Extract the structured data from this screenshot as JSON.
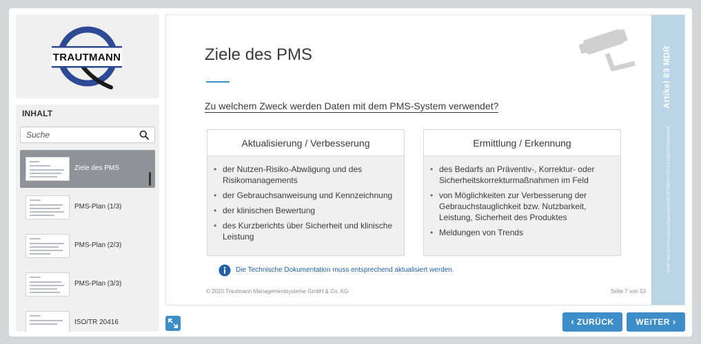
{
  "logo": {
    "text": "TRAUTMANN"
  },
  "sidebar": {
    "heading": "INHALT",
    "search_placeholder": "Suche",
    "items": [
      {
        "label": "Ziele des PMS",
        "active": true
      },
      {
        "label": "PMS-Plan (1/3)",
        "active": false
      },
      {
        "label": "PMS-Plan (2/3)",
        "active": false
      },
      {
        "label": "PMS-Plan (3/3)",
        "active": false
      },
      {
        "label": "ISO/TR 20416",
        "active": false
      }
    ]
  },
  "slide": {
    "title": "Ziele des PMS",
    "question": "Zu welchem Zweck werden Daten mit dem PMS-System verwendet?",
    "cards": [
      {
        "heading": "Aktualisierung / Verbesserung",
        "bullets": [
          "der Nutzen-Risiko-Abwägung und des Risikomanagements",
          "der Gebrauchsanweisung und Kennzeichnung",
          "der klinischen Bewertung",
          "des Kurzberichts über Sicherheit und klinische Leistung"
        ]
      },
      {
        "heading": "Ermittlung / Erkennung",
        "bullets": [
          "des Bedarfs an Präventiv-, Korrektur- oder Sicherheitskorrekturmaßnahmen im Feld",
          "von Möglichkeiten zur Verbesserung der Gebrauchstauglichkeit bzw. Nutzbarkeit, Leistung, Sicherheit des Produktes",
          "Meldungen von Trends"
        ]
      }
    ],
    "info": "Die Technische Dokumentation muss entsprechend aktualisiert werden.",
    "copyright": "© 2020 Trautmann Managementsysteme GmbH & Co. KG",
    "page": "Seite 7 von 53",
    "ribbon_title": "Artikel 83 MDR",
    "ribbon_source": "Quelle: https://eur-lex.europa.eu/legal-content/DE/TXT/PDF/?uri=CELEX:32017R0745&from=DE"
  },
  "nav": {
    "back_label": "ZURÜCK",
    "next_label": "WEITER"
  },
  "colors": {
    "accent": "#3c8dc8",
    "ribbon": "#b9d5e6",
    "active_item": "#8d9399",
    "logo_blue": "#2d4a95"
  }
}
